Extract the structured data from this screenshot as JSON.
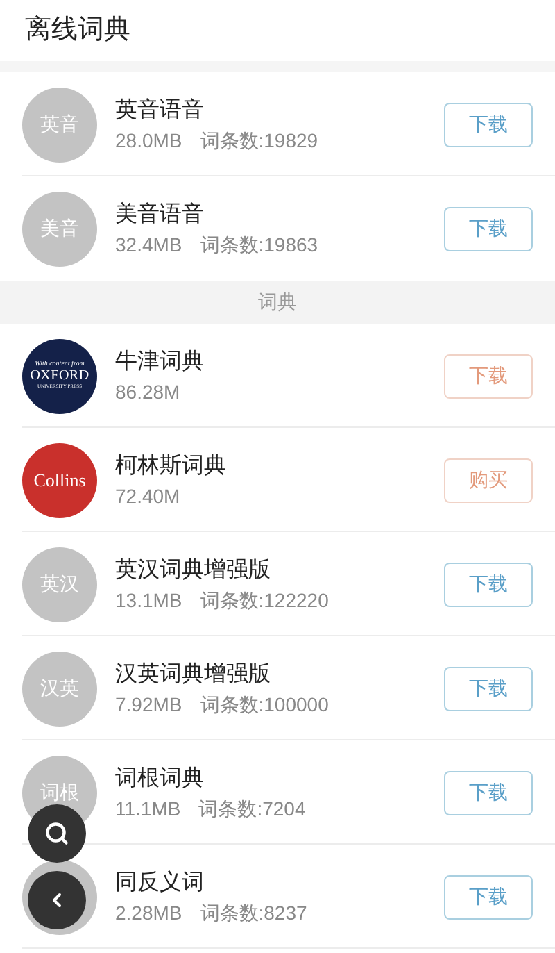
{
  "header": {
    "title": "离线词典"
  },
  "sections": [
    {
      "items": [
        {
          "avatar": {
            "kind": "text",
            "label": "英音"
          },
          "name": "英音语音",
          "size": "28.0MB",
          "entries": "词条数:19829",
          "button": {
            "label": "下载",
            "kind": "free"
          }
        },
        {
          "avatar": {
            "kind": "text",
            "label": "美音"
          },
          "name": "美音语音",
          "size": "32.4MB",
          "entries": "词条数:19863",
          "button": {
            "label": "下载",
            "kind": "free"
          }
        }
      ]
    },
    {
      "heading": "词典",
      "items": [
        {
          "avatar": {
            "kind": "oxford",
            "lines": [
              "With content from",
              "OXFORD",
              "UNIVERSITY PRESS"
            ]
          },
          "name": "牛津词典",
          "size": "86.28M",
          "button": {
            "label": "下载",
            "kind": "premium"
          }
        },
        {
          "avatar": {
            "kind": "collins",
            "lines": [
              "Collins"
            ]
          },
          "name": "柯林斯词典",
          "size": "72.40M",
          "button": {
            "label": "购买",
            "kind": "premium"
          }
        },
        {
          "avatar": {
            "kind": "text",
            "label": "英汉"
          },
          "name": "英汉词典增强版",
          "size": "13.1MB",
          "entries": "词条数:122220",
          "button": {
            "label": "下载",
            "kind": "free"
          }
        },
        {
          "avatar": {
            "kind": "text",
            "label": "汉英"
          },
          "name": "汉英词典增强版",
          "size": "7.92MB",
          "entries": "词条数:100000",
          "button": {
            "label": "下载",
            "kind": "free"
          }
        },
        {
          "avatar": {
            "kind": "text",
            "label": "词根"
          },
          "name": "词根词典",
          "size": "11.1MB",
          "entries": "词条数:7204",
          "button": {
            "label": "下载",
            "kind": "free"
          }
        },
        {
          "avatar": {
            "kind": "text"
          },
          "name": "同反义词",
          "size": "2.28MB",
          "entries": "词条数:8237",
          "button": {
            "label": "下载",
            "kind": "free"
          }
        }
      ]
    }
  ],
  "floating_buttons": [
    {
      "kind": "search"
    },
    {
      "kind": "back"
    }
  ]
}
